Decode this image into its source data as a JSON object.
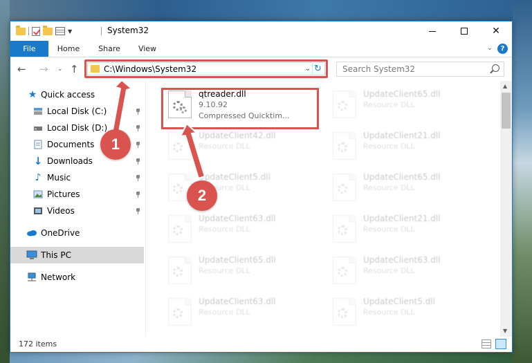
{
  "window": {
    "title": "System32",
    "controls": {
      "minimize": "—",
      "maximize": "☐",
      "close": "✕"
    }
  },
  "ribbon": {
    "tabs": [
      "File",
      "Home",
      "Share",
      "View"
    ],
    "toggle_icon": "chevron-down-icon",
    "help_icon": "?"
  },
  "nav": {
    "address": "C:\\Windows\\System32",
    "search_placeholder": "Search System32",
    "refresh_glyph": "↻",
    "dropdown_glyph": "⌄"
  },
  "sidebar": {
    "items": [
      {
        "label": "Quick access",
        "icon": "star-icon",
        "pinned": false
      },
      {
        "label": "Local Disk (C:)",
        "icon": "drive-icon",
        "pinned": true
      },
      {
        "label": "Local Disk (D:)",
        "icon": "drive-icon",
        "pinned": true
      },
      {
        "label": "Documents",
        "icon": "documents-icon",
        "pinned": true
      },
      {
        "label": "Downloads",
        "icon": "downloads-icon",
        "pinned": true
      },
      {
        "label": "Music",
        "icon": "music-icon",
        "pinned": true
      },
      {
        "label": "Pictures",
        "icon": "pictures-icon",
        "pinned": true
      },
      {
        "label": "Videos",
        "icon": "videos-icon",
        "pinned": true
      },
      {
        "label": "OneDrive",
        "icon": "cloud-icon",
        "pinned": false
      },
      {
        "label": "This PC",
        "icon": "computer-icon",
        "pinned": false,
        "selected": true
      },
      {
        "label": "Network",
        "icon": "network-icon",
        "pinned": false
      }
    ]
  },
  "files": [
    {
      "name": "qtreader.dll",
      "type": "9.10.92",
      "extra": "Compressed Quicktim...",
      "highlighted": true
    },
    {
      "name": "UpdateClient65.dll",
      "type": "Resource DLL"
    },
    {
      "name": "UpdateClient42.dll",
      "type": "Resource DLL"
    },
    {
      "name": "UpdateClient21.dll",
      "type": "Resource DLL"
    },
    {
      "name": "UpdateClient5.dll",
      "type": "Resource DLL"
    },
    {
      "name": "UpdateClient65.dll",
      "type": "Resource DLL"
    },
    {
      "name": "UpdateClient63.dll",
      "type": "Resource DLL"
    },
    {
      "name": "UpdateClient21.dll",
      "type": "Resource DLL"
    },
    {
      "name": "UpdateClient65.dll",
      "type": "Resource DLL"
    },
    {
      "name": "UpdateClient63.dll",
      "type": "Resource DLL"
    },
    {
      "name": "UpdateClient63.dll",
      "type": "Resource DLL"
    },
    {
      "name": "UpdateClient5.dll",
      "type": "Resource DLL"
    }
  ],
  "status": {
    "item_count": "172 items"
  },
  "callouts": {
    "one": "1",
    "two": "2"
  },
  "colors": {
    "accent": "#1979ca",
    "annotation": "#d9534f",
    "selected": "#d9d9d9"
  }
}
